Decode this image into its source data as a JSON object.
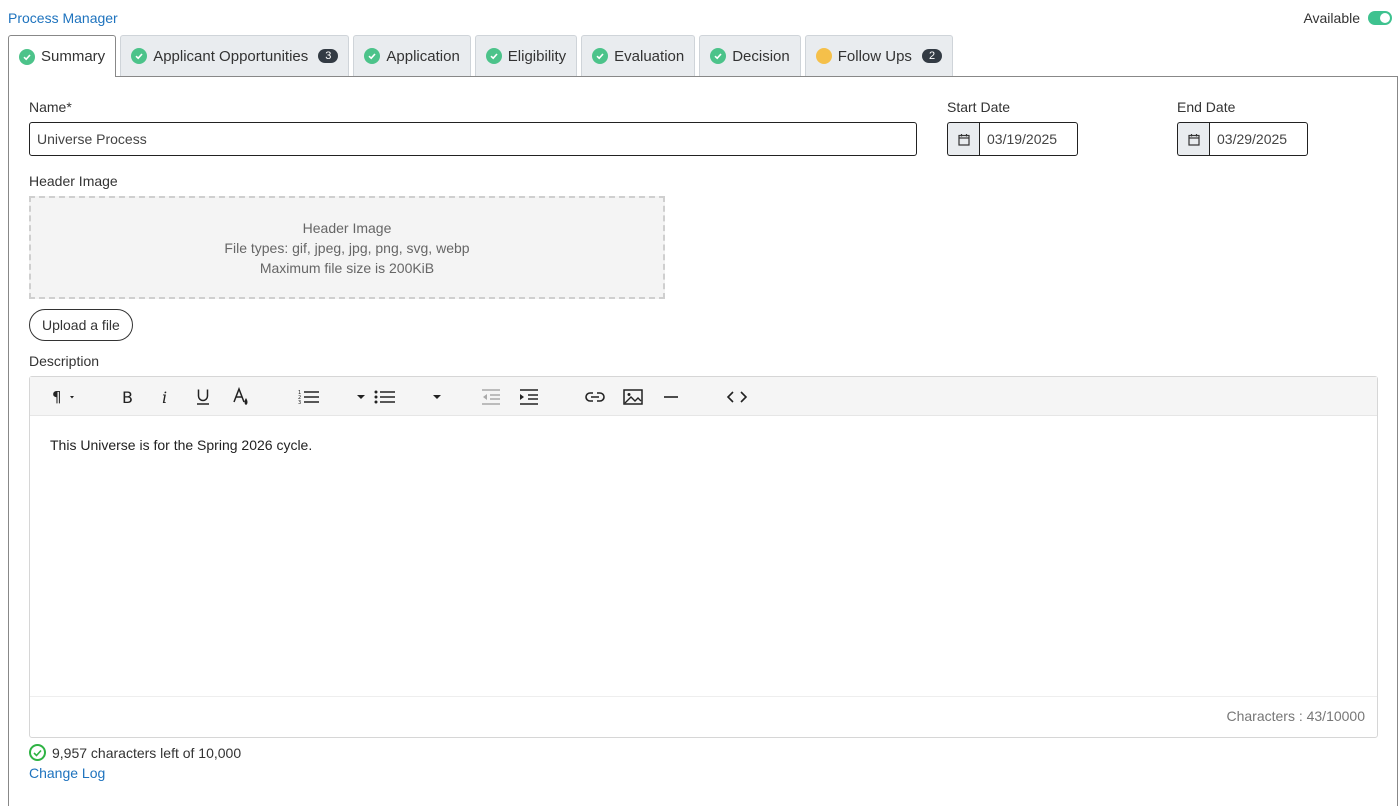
{
  "header": {
    "title": "Process Manager",
    "available_label": "Available",
    "available_on": true
  },
  "tabs": [
    {
      "label": "Summary",
      "status": "complete",
      "active": true
    },
    {
      "label": "Applicant Opportunities",
      "status": "complete",
      "badge": "3"
    },
    {
      "label": "Application",
      "status": "complete"
    },
    {
      "label": "Eligibility",
      "status": "complete"
    },
    {
      "label": "Evaluation",
      "status": "complete"
    },
    {
      "label": "Decision",
      "status": "complete"
    },
    {
      "label": "Follow Ups",
      "status": "pending",
      "badge": "2"
    }
  ],
  "form": {
    "name_label": "Name*",
    "name_value": "Universe Process",
    "start_label": "Start Date",
    "start_value": "03/19/2025",
    "end_label": "End Date",
    "end_value": "03/29/2025",
    "header_image_label": "Header Image",
    "dropzone_title": "Header Image",
    "dropzone_types": "File types: gif, jpeg, jpg, png, svg, webp",
    "dropzone_size": "Maximum file size is 200KiB",
    "upload_label": "Upload a file",
    "description_label": "Description"
  },
  "editor": {
    "toolbar": [
      "paragraph-icon",
      "bold-icon",
      "italic-icon",
      "underline-icon",
      "font-color-icon",
      "ordered-list-icon",
      "unordered-list-icon",
      "outdent-icon",
      "indent-icon",
      "link-icon",
      "image-icon",
      "horizontal-rule-icon",
      "code-view-icon"
    ],
    "content": "This Universe is for the Spring 2026 cycle.",
    "counter": "Characters : 43/10000"
  },
  "footer": {
    "chars_left": "9,957 characters left of 10,000",
    "change_log": "Change Log"
  },
  "colors": {
    "accent": "#1e73be",
    "success": "#4cc38a",
    "pending": "#f5c04a",
    "badge": "#333b44"
  }
}
